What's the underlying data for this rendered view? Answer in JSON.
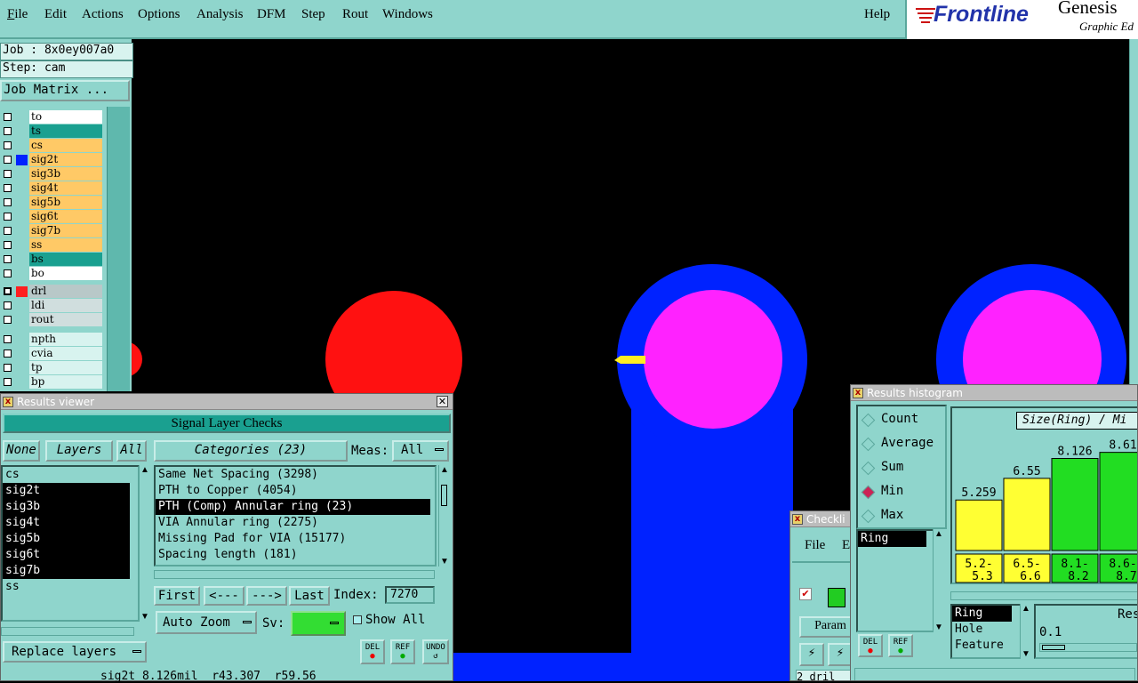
{
  "menubar": {
    "items": [
      "File",
      "Edit",
      "Actions",
      "Options",
      "Analysis",
      "DFM",
      "Step",
      "Rout",
      "Windows"
    ],
    "help": "Help",
    "logo": "Frontline",
    "product": "Genesis",
    "subtitle": "Graphic Ed"
  },
  "left": {
    "job": "Job : 8x0ey007a0",
    "step": "Step: cam",
    "job_matrix": "Job Matrix ...",
    "layers": [
      {
        "name": "to",
        "bg": "#ffffff",
        "chk": false,
        "sq": ""
      },
      {
        "name": "ts",
        "bg": "#1aa090",
        "chk": false,
        "sq": ""
      },
      {
        "name": "cs",
        "bg": "#ffc966",
        "chk": false,
        "sq": ""
      },
      {
        "name": "sig2t",
        "bg": "#ffc966",
        "chk": false,
        "sq": "#0022ff"
      },
      {
        "name": "sig3b",
        "bg": "#ffc966",
        "chk": false,
        "sq": ""
      },
      {
        "name": "sig4t",
        "bg": "#ffc966",
        "chk": false,
        "sq": ""
      },
      {
        "name": "sig5b",
        "bg": "#ffc966",
        "chk": false,
        "sq": ""
      },
      {
        "name": "sig6t",
        "bg": "#ffc966",
        "chk": false,
        "sq": ""
      },
      {
        "name": "sig7b",
        "bg": "#ffc966",
        "chk": false,
        "sq": ""
      },
      {
        "name": "ss",
        "bg": "#ffc966",
        "chk": false,
        "sq": ""
      },
      {
        "name": "bs",
        "bg": "#1aa090",
        "chk": false,
        "sq": ""
      },
      {
        "name": "bo",
        "bg": "#ffffff",
        "chk": false,
        "sq": ""
      },
      {
        "name": "drl",
        "bg": "#b8c8c8",
        "chk": true,
        "sq": "#ff2020"
      },
      {
        "name": "ldi",
        "bg": "#d0dede",
        "chk": false,
        "sq": ""
      },
      {
        "name": "rout",
        "bg": "#d0dede",
        "chk": false,
        "sq": ""
      },
      {
        "name": "npth",
        "bg": "#d8f3ef",
        "chk": false,
        "sq": ""
      },
      {
        "name": "cvia",
        "bg": "#d8f3ef",
        "chk": false,
        "sq": ""
      },
      {
        "name": "tp",
        "bg": "#d8f3ef",
        "chk": false,
        "sq": ""
      },
      {
        "name": "bp",
        "bg": "#d8f3ef",
        "chk": false,
        "sq": ""
      }
    ]
  },
  "results_viewer": {
    "title": "Results viewer",
    "header": "Signal Layer Checks",
    "none": "None",
    "layers": "Layers",
    "all": "All",
    "categories": "Categories (23)",
    "meas_label": "Meas:",
    "meas_value": "All",
    "layer_list": [
      {
        "t": "cs",
        "sel": false
      },
      {
        "t": "sig2t",
        "sel": true
      },
      {
        "t": "sig3b",
        "sel": true
      },
      {
        "t": "sig4t",
        "sel": true
      },
      {
        "t": "sig5b",
        "sel": true
      },
      {
        "t": "sig6t",
        "sel": true
      },
      {
        "t": "sig7b",
        "sel": true
      },
      {
        "t": "ss",
        "sel": false
      }
    ],
    "category_list": [
      {
        "t": "Same Net Spacing (3298)",
        "sel": false
      },
      {
        "t": "PTH to Copper (4054)",
        "sel": false
      },
      {
        "t": "PTH (Comp) Annular ring (23)",
        "sel": true
      },
      {
        "t": "VIA Annular ring (2275)",
        "sel": false
      },
      {
        "t": "Missing Pad for VIA (15177)",
        "sel": false
      },
      {
        "t": "Spacing length (181)",
        "sel": false
      }
    ],
    "first": "First",
    "prev": "<---",
    "next": "--->",
    "last": "Last",
    "index_label": "Index:",
    "index_value": "7270",
    "auto_zoom": "Auto Zoom",
    "sv": "Sv:",
    "show_all": "Show All",
    "replace_layers": "Replace layers",
    "del": "DEL",
    "ref": "REF",
    "undo": "UNDO"
  },
  "status": "sig2t 8.126mil  r43.307  r59.56",
  "checklist": {
    "title": "Checkli",
    "file": "File",
    "edit": "E",
    "param": "Param",
    "drill": "2 dril"
  },
  "histogram": {
    "title": "Results histogram",
    "modes": [
      {
        "t": "Count",
        "sel": false
      },
      {
        "t": "Average",
        "sel": false
      },
      {
        "t": "Sum",
        "sel": false
      },
      {
        "t": "Min",
        "sel": true
      },
      {
        "t": "Max",
        "sel": false
      }
    ],
    "left_list": [
      "Ring"
    ],
    "chart_title": "Size(Ring) / Mi",
    "res_label": "Reso",
    "res_value": "0.1",
    "measures": [
      {
        "t": "Ring",
        "sel": true
      },
      {
        "t": "Hole",
        "sel": false
      },
      {
        "t": "Feature",
        "sel": false
      }
    ],
    "del": "DEL",
    "ref": "REF"
  },
  "chart_data": {
    "type": "bar",
    "title": "Size(Ring) / Mi",
    "categories": [
      "5.2-5.3",
      "6.5-6.6",
      "8.1-8.2",
      "8.6-8.7"
    ],
    "values": [
      5.259,
      6.55,
      8.126,
      8.61
    ],
    "labels": [
      "5.259",
      "6.55",
      "8.126",
      "8.61"
    ],
    "colors": [
      "#ffff33",
      "#ffff33",
      "#22dd22",
      "#22dd22"
    ]
  }
}
